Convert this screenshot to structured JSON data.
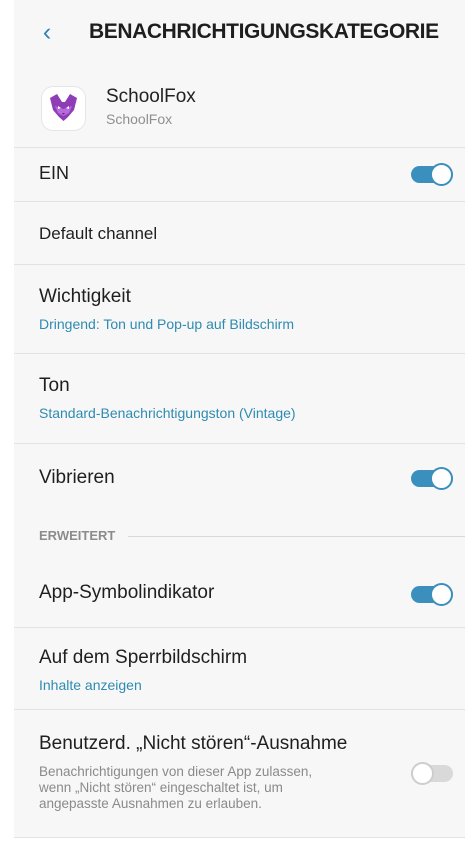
{
  "header": {
    "back_icon": "chevron-left-icon",
    "title": "BENACHRICHTIGUNGSKATEGORIE"
  },
  "app": {
    "name": "SchoolFox",
    "subtitle": "SchoolFox",
    "icon": "schoolfox-logo-icon"
  },
  "settings": {
    "master": {
      "label": "EIN",
      "enabled": true
    },
    "channel": {
      "label": "Default channel"
    },
    "importance": {
      "label": "Wichtigkeit",
      "value": "Dringend: Ton und Pop-up auf Bildschirm"
    },
    "sound": {
      "label": "Ton",
      "value": "Standard-Benachrichtigungston (Vintage)"
    },
    "vibrate": {
      "label": "Vibrieren",
      "enabled": true
    },
    "advanced": {
      "section_label": "ERWEITERT"
    },
    "badge": {
      "label": "App-Symbolindikator",
      "enabled": true
    },
    "lockscreen": {
      "label": "Auf dem Sperrbildschirm",
      "value": "Inhalte anzeigen"
    },
    "dnd": {
      "label": "Benutzerd. „Nicht stören“-Ausnahme",
      "description_line1": "Benachrichtigungen von dieser App zulassen,",
      "description_line2": "wenn „Nicht stören“ eingeschaltet ist, um",
      "description_line3": "angepasste Ausnahmen zu erlauben.",
      "enabled": false
    }
  },
  "colors": {
    "accent": "#3b8fbd",
    "link_text": "#2f8bb2",
    "background": "#f7f7f7"
  }
}
